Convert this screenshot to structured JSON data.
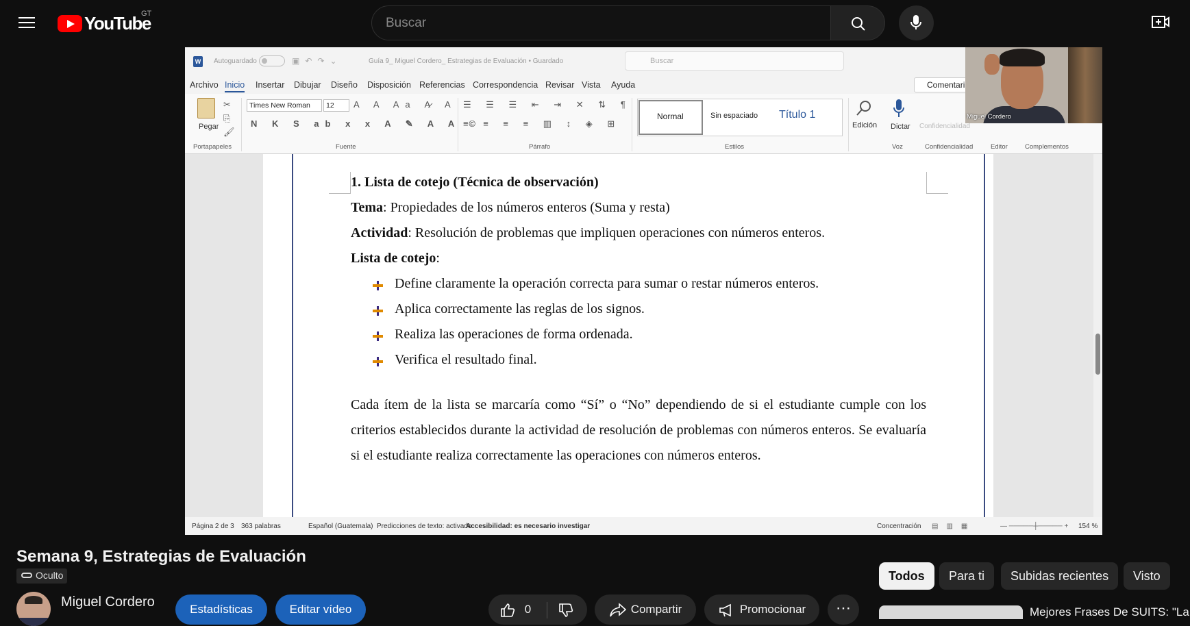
{
  "header": {
    "logo_text": "YouTube",
    "country_code": "GT",
    "search_placeholder": "Buscar"
  },
  "word": {
    "autosave_label": "Autoguardado",
    "document_name": "Guía 9_ Miguel Cordero_ Estrategias de Evaluación • Guardado",
    "search_placeholder": "Buscar",
    "menu": [
      "Archivo",
      "Inicio",
      "Insertar",
      "Dibujar",
      "Diseño",
      "Disposición",
      "Referencias",
      "Correspondencia",
      "Revisar",
      "Vista",
      "Ayuda"
    ],
    "comment_button": "Comentari",
    "ribbon": {
      "paste_label": "Pegar",
      "font_name": "Times New Roman",
      "font_size": "12",
      "styles": [
        "Normal",
        "Sin espaciado",
        "Título 1"
      ],
      "edition_label": "Edición",
      "dictate_label": "Dictar",
      "confidential_label": "Confidencialidad",
      "editor_label": "Editor",
      "addins_label": "Complementos",
      "groups": [
        "Portapapeles",
        "Fuente",
        "Párrafo",
        "Estilos",
        "Voz",
        "Confidencialidad",
        "Editor",
        "Complementos"
      ]
    },
    "document": {
      "heading": "1. Lista de cotejo (Técnica de observación)",
      "tema_label": "Tema",
      "tema_value": ": Propiedades de los números enteros (Suma y resta)",
      "actividad_label": "Actividad",
      "actividad_value": ": Resolución de problemas que impliquen operaciones con números enteros.",
      "lista_label": "Lista de cotejo",
      "lista_colon": ":",
      "bullets": [
        "Define claramente la operación correcta para sumar o restar números enteros.",
        "Aplica correctamente las reglas de los signos.",
        "Realiza las operaciones de forma ordenada.",
        "Verifica el resultado final."
      ],
      "paragraph": "Cada ítem de la lista se marcaría como “Sí” o “No” dependiendo de si el estudiante cumple con los criterios establecidos durante la actividad de resolución de problemas con números enteros. Se evaluaría si el estudiante realiza correctamente las operaciones con números enteros."
    },
    "status": {
      "page": "Página 2 de 3",
      "words": "363 palabras",
      "language": "Español (Guatemala)",
      "predictions": "Predicciones de texto: activado",
      "accessibility": "Accesibilidad: es necesario investigar",
      "focus": "Concentración",
      "zoom": "154 %"
    },
    "webcam_name": "Miguel Cordero"
  },
  "video": {
    "title": "Semana 9, Estrategias de Evaluación",
    "visibility": "Oculto",
    "channel": "Miguel Cordero",
    "stats_button": "Estadísticas",
    "edit_button": "Editar vídeo",
    "likes": "0",
    "share_button": "Compartir",
    "promote_button": "Promocionar"
  },
  "chips": [
    "Todos",
    "Para ti",
    "Subidas recientes",
    "Visto"
  ],
  "recommended": {
    "title": "Mejores Frases De SUITS: \"La"
  }
}
